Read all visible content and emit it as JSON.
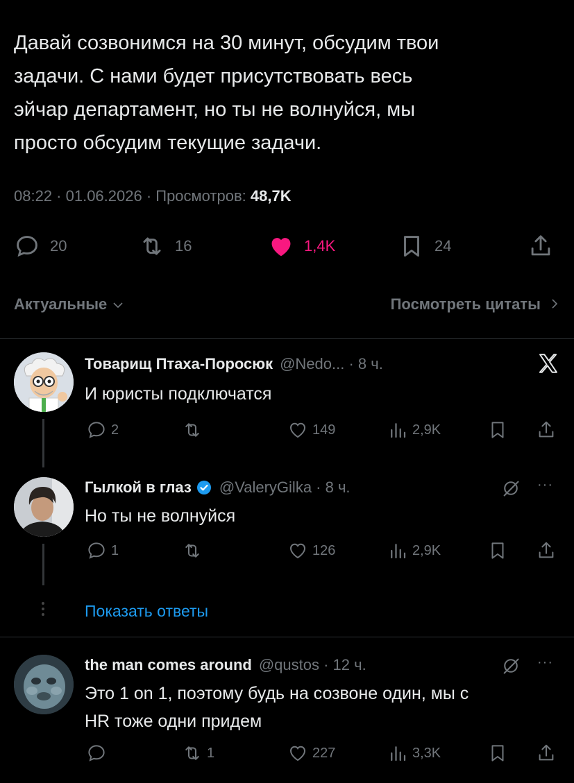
{
  "tweet": {
    "text": "Давай созвонимся на 30 минут, обсудим твои\nзадачи. С нами будет присутствовать  весь\nэйчар департамент, но ты не волнуйся, мы\nпросто обсудим текущие задачи.",
    "meta_prefix": "08:22 · 01.06.2026 · Просмотров: ",
    "views": "48,7K",
    "actions": {
      "replies": "20",
      "reposts": "16",
      "likes": "1,4K",
      "bookmarks": "24"
    },
    "colors": {
      "like": "#f91880",
      "muted": "#71767b",
      "link": "#1d9bf0"
    }
  },
  "tabs": {
    "sort_label": "Актуальные",
    "quotes_label": "Посмотреть цитаты"
  },
  "replies": [
    {
      "name": "Товарищ Птаха-Поросюк",
      "handle": "@Nedo... · 8 ч.",
      "text": "И юристы подключатся",
      "replies": "2",
      "reposts": "",
      "likes": "149",
      "views": "2,9K",
      "corner_icon": "x-logo-icon"
    },
    {
      "name": "Гылкой в глаз",
      "handle": "@ValeryGilka · 8 ч.",
      "verified": true,
      "text": "Но ты не волнуйся",
      "replies": "1",
      "reposts": "",
      "likes": "126",
      "views": "2,9K",
      "corner_icon": "grok-icon"
    },
    {
      "name": "the man comes around",
      "handle": "@qustos · 12 ч.",
      "text": "Это 1 on 1, поэтому будь на созвоне один, мы с\nHR тоже одни придем",
      "replies": "",
      "reposts": "1",
      "likes": "227",
      "views": "3,3K",
      "corner_icon": "grok-icon"
    }
  ],
  "show_replies_label": "Показать ответы"
}
